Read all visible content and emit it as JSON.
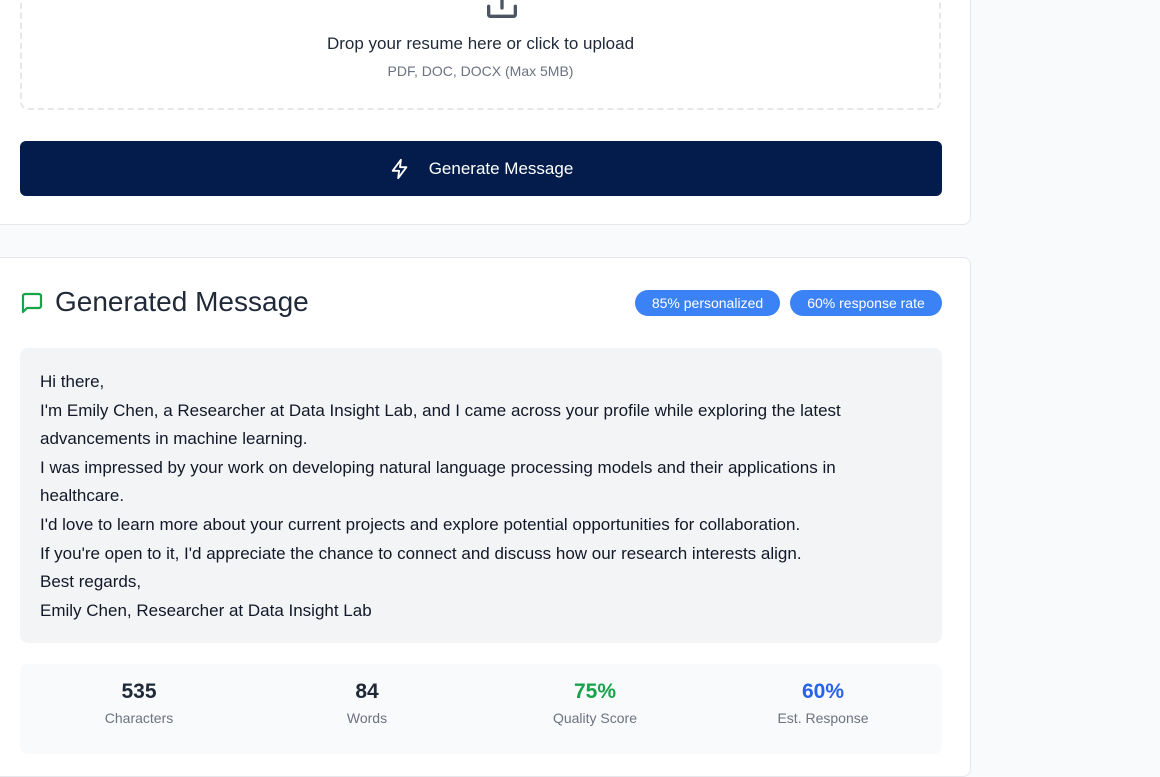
{
  "upload": {
    "title": "Drop your resume here or click to upload",
    "subtitle": "PDF, DOC, DOCX (Max 5MB)",
    "icon": "upload-icon"
  },
  "generate_button": {
    "label": "Generate Message",
    "icon": "lightning-icon"
  },
  "generated": {
    "title": "Generated Message",
    "icon": "chat-icon",
    "badges": [
      "85% personalized",
      "60% response rate"
    ],
    "message_lines": [
      "Hi there,",
      "I'm Emily Chen, a Researcher at Data Insight Lab, and I came across your profile while exploring the latest advancements in machine learning.",
      "I was impressed by your work on developing natural language processing models and their applications in healthcare.",
      "I'd love to learn more about your current projects and explore potential opportunities for collaboration.",
      "If you're open to it, I'd appreciate the chance to connect and discuss how our research interests align.",
      "Best regards,",
      "Emily Chen, Researcher at Data Insight Lab"
    ]
  },
  "stats": [
    {
      "value": "535",
      "label": "Characters",
      "color": "#1f2937"
    },
    {
      "value": "84",
      "label": "Words",
      "color": "#1f2937"
    },
    {
      "value": "75%",
      "label": "Quality Score",
      "color": "#16a34a"
    },
    {
      "value": "60%",
      "label": "Est. Response",
      "color": "#2563eb"
    }
  ],
  "colors": {
    "primary_button": "#031c4b",
    "badge": "#3b82f6",
    "chat_icon": "#16a34a"
  }
}
